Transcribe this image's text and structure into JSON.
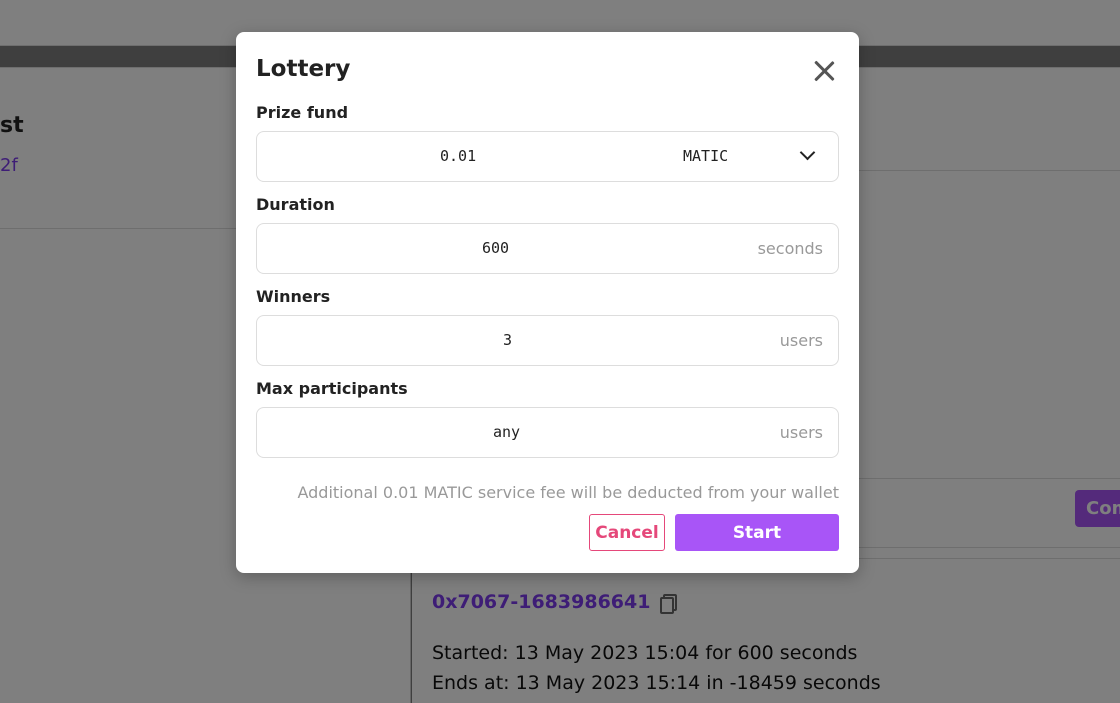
{
  "background": {
    "left_card_title": "st",
    "left_card_link": "2f",
    "comment_button_label": "Com",
    "lottery_id": "0x7067-1683986641",
    "started_text": "Started: 13 May 2023 15:04 for 600 seconds",
    "ends_text": "Ends at: 13 May 2023 15:14 in -18459 seconds"
  },
  "modal": {
    "title": "Lottery",
    "close_icon": "close-icon",
    "prize_fund": {
      "label": "Prize fund",
      "value": "0.01",
      "currency": "MATIC"
    },
    "duration": {
      "label": "Duration",
      "value": "600",
      "unit": "seconds"
    },
    "winners": {
      "label": "Winners",
      "value": "3",
      "unit": "users"
    },
    "max_participants": {
      "label": "Max participants",
      "value": "any",
      "unit": "users"
    },
    "fee_note": "Additional 0.01 MATIC service fee will be deducted from your wallet",
    "cancel_label": "Cancel",
    "start_label": "Start"
  },
  "colors": {
    "accent": "#a855f7",
    "cancel": "#e5487a",
    "link": "#7c3aed"
  }
}
